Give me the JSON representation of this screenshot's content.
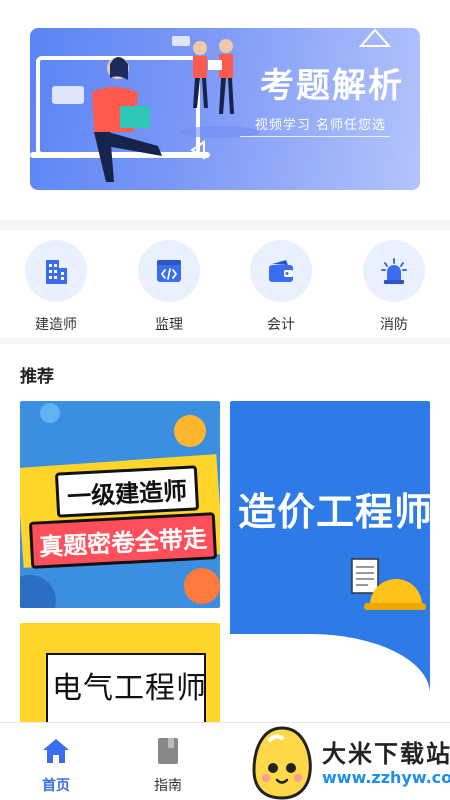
{
  "banner": {
    "title": "考题解析",
    "subtitle": "视频学习  名师任您选"
  },
  "categories": [
    {
      "label": "建造师",
      "icon": "building-icon"
    },
    {
      "label": "监理",
      "icon": "code-icon"
    },
    {
      "label": "会计",
      "icon": "wallet-icon"
    },
    {
      "label": "消防",
      "icon": "alarm-icon"
    }
  ],
  "recommend": {
    "title": "推荐",
    "cards": [
      {
        "line1": "一级建造师",
        "line2": "真题密卷全带走"
      },
      {
        "line1": "造价工程师"
      },
      {
        "line1": "电气工程师"
      }
    ]
  },
  "tabs": [
    {
      "label": "首页",
      "icon": "home-icon",
      "active": true
    },
    {
      "label": "指南",
      "icon": "book-icon",
      "active": false
    }
  ],
  "watermark": {
    "title": "大米下载站",
    "url": "www.zzhyw.com"
  },
  "colors": {
    "accent": "#3a6df0",
    "icon_bg": "#eaf0fd"
  }
}
